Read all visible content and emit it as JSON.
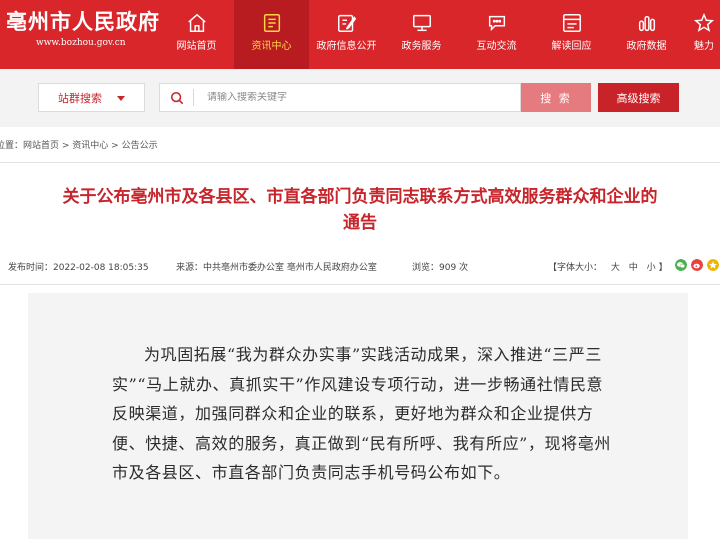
{
  "header": {
    "site_title": "亳州市人民政府",
    "site_url": "www.bozhou.gov.cn",
    "nav": [
      {
        "label": "网站首页",
        "icon": "home-icon",
        "active": false
      },
      {
        "label": "资讯中心",
        "icon": "news-icon",
        "active": true
      },
      {
        "label": "政府信息公开",
        "icon": "edit-document-icon",
        "active": false
      },
      {
        "label": "政务服务",
        "icon": "monitor-icon",
        "active": false
      },
      {
        "label": "互动交流",
        "icon": "chat-icon",
        "active": false
      },
      {
        "label": "解读回应",
        "icon": "window-icon",
        "active": false
      },
      {
        "label": "政府数据",
        "icon": "bar-chart-icon",
        "active": false
      },
      {
        "label": "魅力",
        "icon": "star-icon",
        "active": false
      }
    ],
    "colors": {
      "primary": "#d8262b",
      "active": "#b81c21"
    }
  },
  "search": {
    "site_select_label": "站群搜索",
    "placeholder": "请输入搜索关键字",
    "search_button": "搜 索",
    "advanced_button": "高级搜索"
  },
  "breadcrumb": {
    "prefix": "位置：",
    "items": [
      "网站首页",
      "资讯中心",
      "公告公示"
    ],
    "separator": " > "
  },
  "article": {
    "title_line1": "关于公布亳州市及各县区、市直各部门负责同志联系方式高效服务群众和企业的",
    "title_line2": "通告",
    "publish_time": "发布时间：2022-02-08 18:05:35",
    "source": "来源：中共亳州市委办公室 亳州市人民政府办公室",
    "views": "浏览：909 次",
    "font_size_label": "【字体大小：",
    "font_large": "大",
    "font_medium": "中",
    "font_small": "小",
    "font_size_end": "】",
    "body": "为巩固拓展“我为群众办实事”实践活动成果，深入推进“三严三实”“马上就办、真抓实干”作风建设专项行动，进一步畅通社情民意反映渠道，加强同群众和企业的联系，更好地为群众和企业提供方便、快捷、高效的服务，真正做到“民有所呼、我有所应”，现将亳州市及各县区、市直各部门负责同志手机号码公布如下。"
  },
  "share": {
    "icons": [
      "wechat-icon",
      "weibo-icon",
      "qzone-icon"
    ],
    "colors": [
      "#4caf50",
      "#e64340",
      "#f0b400"
    ]
  }
}
